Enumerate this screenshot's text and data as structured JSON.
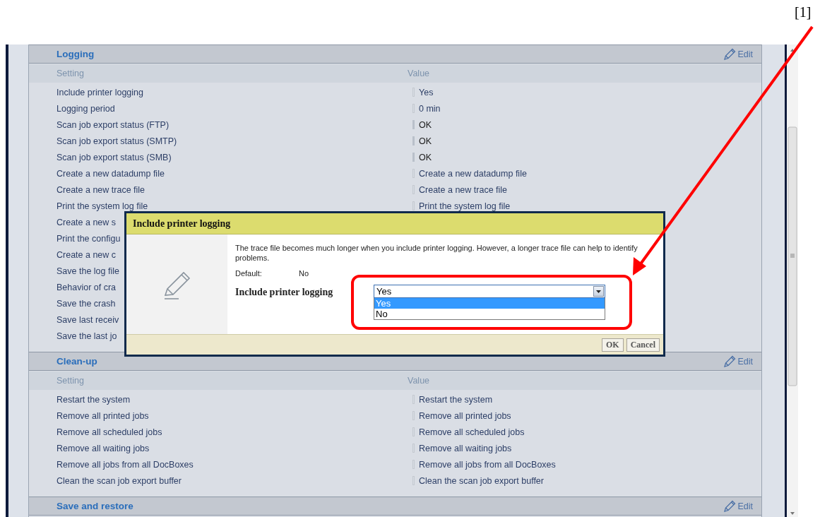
{
  "callout": {
    "label": "[1]"
  },
  "sections": [
    {
      "title": "Logging",
      "edit": "Edit",
      "columns": [
        "Setting",
        "Value"
      ],
      "rows": [
        {
          "setting": "Include printer logging",
          "value": "Yes",
          "kind": "setting"
        },
        {
          "setting": "Logging period",
          "value": "0 min",
          "kind": "setting"
        },
        {
          "setting": "Scan job export status (FTP)",
          "value": "OK",
          "kind": "status"
        },
        {
          "setting": "Scan job export status (SMTP)",
          "value": "OK",
          "kind": "status"
        },
        {
          "setting": "Scan job export status (SMB)",
          "value": "OK",
          "kind": "status"
        },
        {
          "setting": "Create a new datadump file",
          "value": "Create a new datadump file",
          "kind": "setting"
        },
        {
          "setting": "Create a new trace file",
          "value": "Create a new trace file",
          "kind": "setting"
        },
        {
          "setting": "Print the system log file",
          "value": "Print the system log file",
          "kind": "setting"
        },
        {
          "setting": "Create a new s"
        },
        {
          "setting": "Print the configu"
        },
        {
          "setting": "Create a new c"
        },
        {
          "setting": "Save the log file"
        },
        {
          "setting": "Behavior of cra"
        },
        {
          "setting": "Save the crash"
        },
        {
          "setting": "Save last receiv"
        },
        {
          "setting": "Save the last jo"
        }
      ]
    },
    {
      "title": "Clean-up",
      "edit": "Edit",
      "columns": [
        "Setting",
        "Value"
      ],
      "rows": [
        {
          "setting": "Restart the system",
          "value": "Restart the system",
          "kind": "setting"
        },
        {
          "setting": "Remove all printed jobs",
          "value": "Remove all printed jobs",
          "kind": "setting"
        },
        {
          "setting": "Remove all scheduled jobs",
          "value": "Remove all scheduled jobs",
          "kind": "setting"
        },
        {
          "setting": "Remove all waiting jobs",
          "value": "Remove all waiting jobs",
          "kind": "setting"
        },
        {
          "setting": "Remove all jobs from all DocBoxes",
          "value": "Remove all jobs from all DocBoxes",
          "kind": "setting"
        },
        {
          "setting": "Clean the scan job export buffer",
          "value": "Clean the scan job export buffer",
          "kind": "setting"
        }
      ]
    },
    {
      "title": "Save and restore",
      "edit": "Edit"
    }
  ],
  "dialog": {
    "title": "Include printer logging",
    "description": "The trace file becomes much longer when you include printer logging. However, a longer trace file can help to identify problems.",
    "default_label": "Default:",
    "default_value": "No",
    "field_label": "Include printer logging",
    "value": "Yes",
    "expanded": true,
    "options": [
      {
        "label": "Yes",
        "selected": true
      },
      {
        "label": "No",
        "selected": false
      }
    ],
    "buttons": [
      "OK",
      "Cancel"
    ]
  }
}
